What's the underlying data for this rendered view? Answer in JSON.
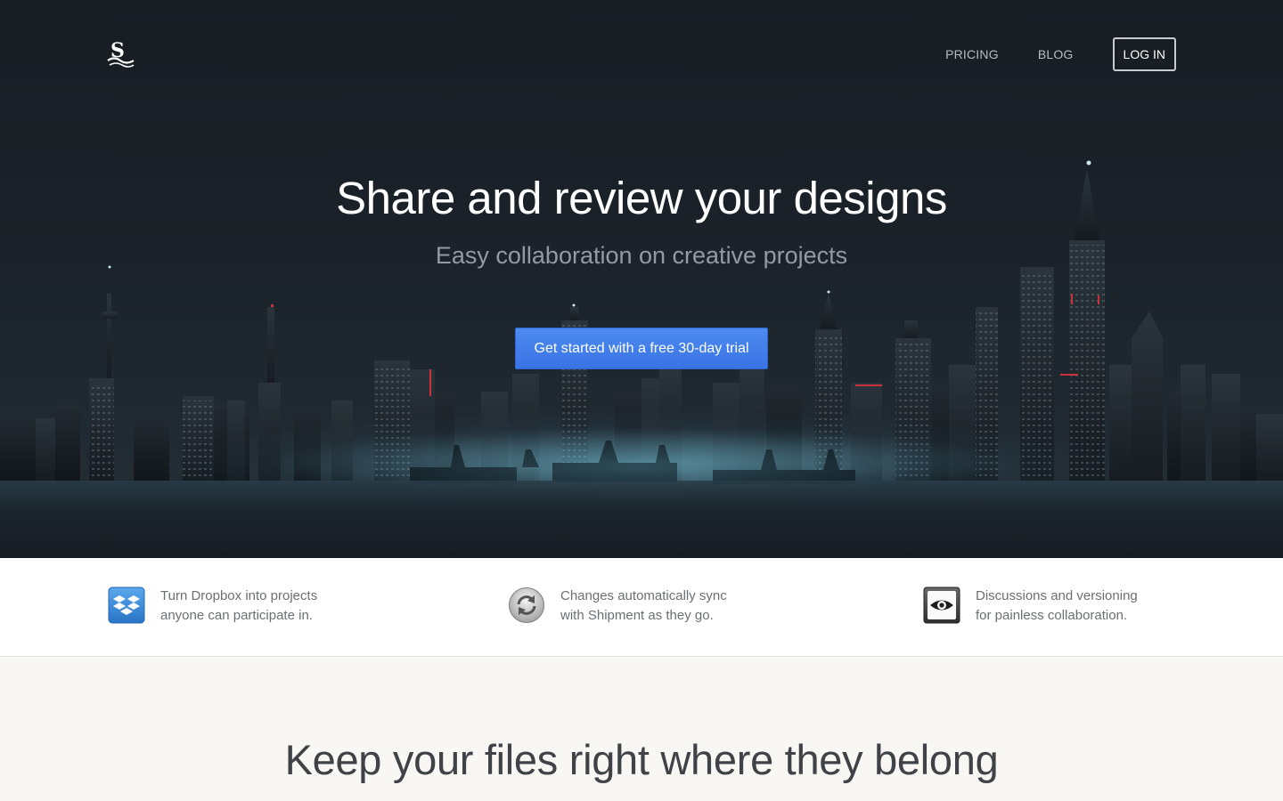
{
  "nav": {
    "pricing": "PRICING",
    "blog": "BLOG",
    "login": "LOG IN"
  },
  "hero": {
    "title": "Share and review your designs",
    "subtitle": "Easy collaboration on creative projects",
    "cta": "Get started with a free 30-day trial",
    "cta_color": "#3f7ce9"
  },
  "features": [
    {
      "icon": "dropbox-icon",
      "line1": "Turn Dropbox into projects",
      "line2": "anyone can participate in."
    },
    {
      "icon": "sync-icon",
      "line1": "Changes automatically sync",
      "line2": "with Shipment as they go."
    },
    {
      "icon": "eye-icon",
      "line1": "Discussions and versioning",
      "line2": "for painless collaboration."
    }
  ],
  "section": {
    "title": "Keep your files right where they belong"
  }
}
